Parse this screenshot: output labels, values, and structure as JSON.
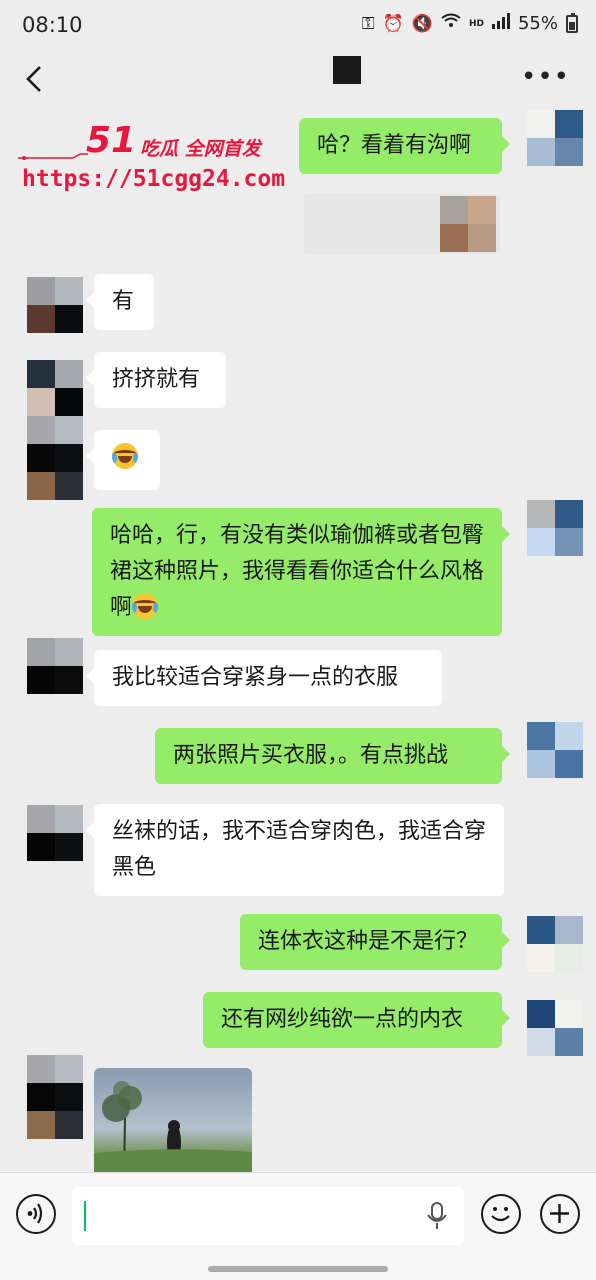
{
  "status": {
    "time": "08:10",
    "battery": "55%",
    "network": "HD"
  },
  "header": {
    "back_icon": "chevron-left-icon",
    "more_icon": "more-dots-icon"
  },
  "watermark": {
    "brand": "51",
    "tag": "吃瓜 全网首发",
    "url": "https://51cgg24.com"
  },
  "messages": [
    {
      "side": "out",
      "text": "哈？看着有沟啊"
    },
    {
      "side": "in",
      "text": "有"
    },
    {
      "side": "in",
      "text": "挤挤就有"
    },
    {
      "side": "in",
      "emoji": "laughing-crying-emoji"
    },
    {
      "side": "out",
      "text": "哈哈，行，有没有类似瑜伽裤或者包臀裙这种照片，我得看看你适合什么风格啊"
    },
    {
      "side": "in",
      "text": "我比较适合穿紧身一点的衣服"
    },
    {
      "side": "out",
      "text": "两张照片买衣服，。有点挑战"
    },
    {
      "side": "in",
      "text": "丝袜的话，我不适合穿肉色，我适合穿黑色"
    },
    {
      "side": "out",
      "text": "连体衣这种是不是行？"
    },
    {
      "side": "out",
      "text": "还有网纱纯欲一点的内衣"
    },
    {
      "side": "in",
      "image": "photo-thumbnail"
    }
  ],
  "colors": {
    "out_bubble": "#95ec69",
    "in_bubble": "#ffffff",
    "background": "#ededed",
    "accent": "#07c160",
    "watermark": "#e8173e"
  }
}
